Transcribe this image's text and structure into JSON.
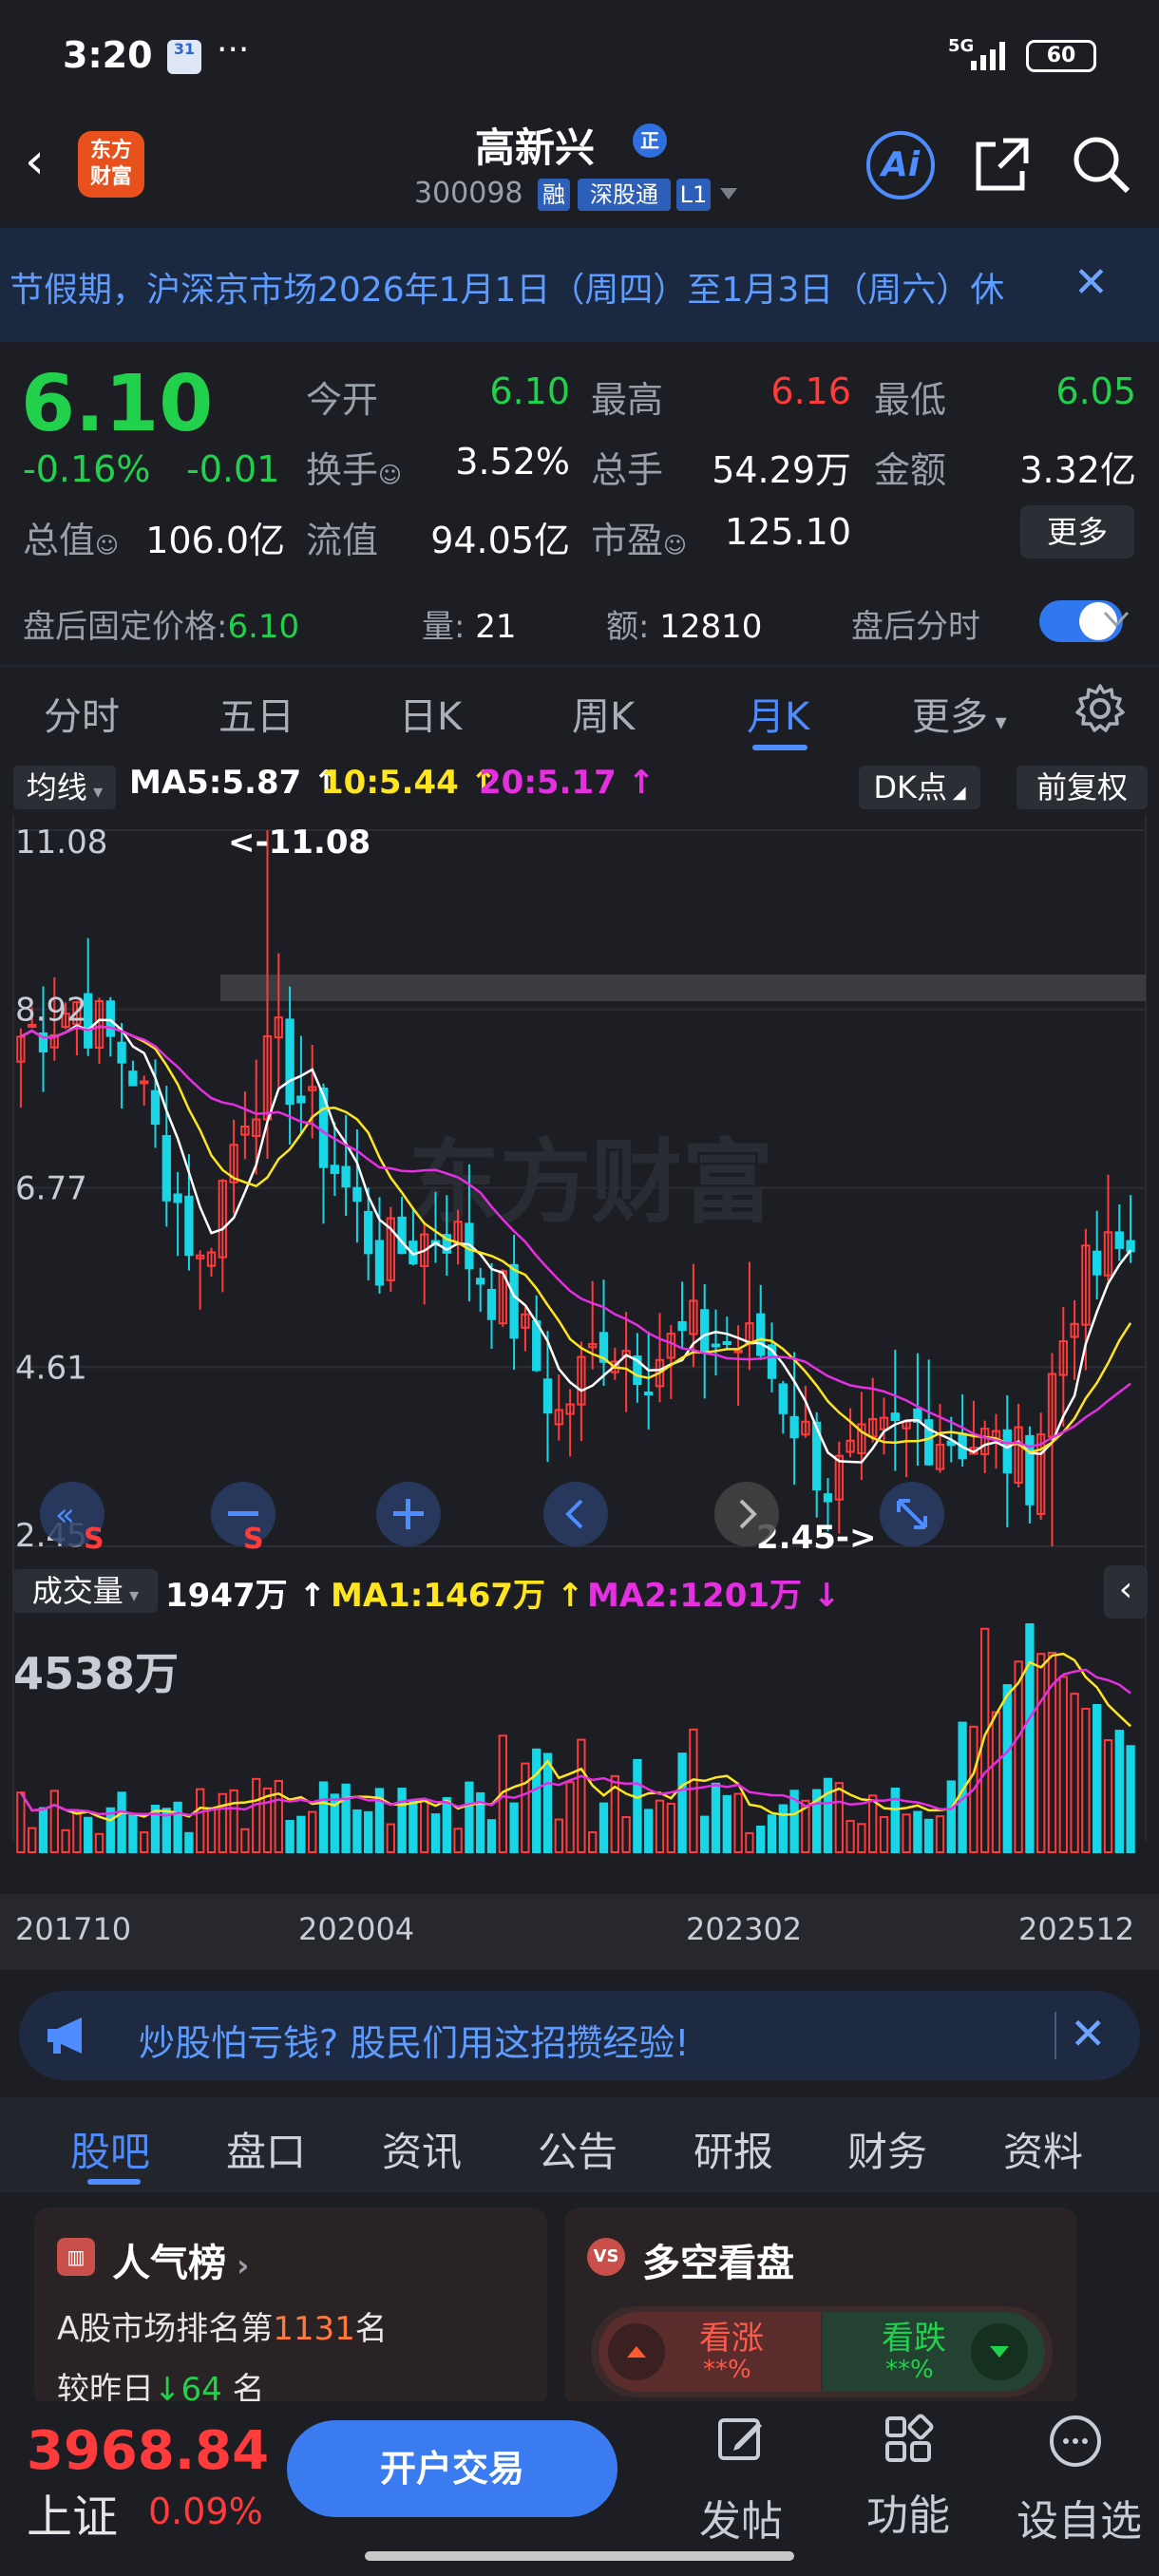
{
  "status": {
    "time": "3:20",
    "cal": "31",
    "dots": "···",
    "net": "5G",
    "battery": "60"
  },
  "header": {
    "logo": "东方\n财富",
    "title": "高新兴",
    "badge": "正",
    "code": "300098",
    "tags": [
      "融",
      "深股通",
      "L1"
    ]
  },
  "notice": {
    "text": "节假期，沪深京市场2026年1月1日（周四）至1月3日（周六）休",
    "close": "✕"
  },
  "quote": {
    "price": "6.10",
    "change_pct": "-0.16%",
    "change": "-0.01",
    "rows": [
      [
        {
          "l": "今开",
          "v": "6.10",
          "c": "gr"
        },
        {
          "l": "最高",
          "v": "6.16",
          "c": "rd"
        },
        {
          "l": "最低",
          "v": "6.05",
          "c": "gr"
        }
      ],
      [
        {
          "l": "换手",
          "v": "3.52%",
          "c": ""
        },
        {
          "l": "总手",
          "v": "54.29万",
          "c": ""
        },
        {
          "l": "金额",
          "v": "3.32亿",
          "c": ""
        }
      ],
      [
        {
          "l": "总值",
          "v": "106.0亿",
          "c": ""
        },
        {
          "l": "流值",
          "v": "94.05亿",
          "c": ""
        },
        {
          "l": "市盈",
          "v": "125.10",
          "c": ""
        }
      ]
    ],
    "more": "更多"
  },
  "after": {
    "fixed_label": "盘后固定价格:",
    "fixed_value": "6.10",
    "vol_label": "量:",
    "vol_value": "21",
    "amt_label": "额:",
    "amt_value": "12810",
    "switch_label": "盘后分时"
  },
  "tabs": [
    "分时",
    "五日",
    "日K",
    "周K",
    "月K",
    "更多"
  ],
  "active_tab": 4,
  "chart": {
    "ma_selector": "均线",
    "ma5": "MA5:5.87 ↑",
    "ma10": "10:5.44 ↑",
    "ma20": "20:5.17 ↑",
    "dk": "DK点",
    "fq": "前复权",
    "max_label": "<-11.08",
    "min_label": "2.45->",
    "y_ticks": [
      "11.08",
      "8.92",
      "6.77",
      "4.61",
      "2.45"
    ],
    "watermark": "东方财富",
    "vol_selector": "成交量",
    "vol_now": "1947万 ↑",
    "ma1": "MA1:1467万 ↑",
    "ma2": "MA2:1201万 ↓",
    "vol_max": "4538万",
    "x_ticks": [
      "201710",
      "202004",
      "202302",
      "202512"
    ],
    "colors": {
      "up": "#ff3b3b",
      "down": "#19d6e6",
      "ma5": "#ffffff",
      "ma10": "#ffe51f",
      "ma20": "#e52fe0"
    }
  },
  "chart_data": {
    "type": "candlestick",
    "xlabels": [
      "201710",
      "202004",
      "202302",
      "202512"
    ],
    "ylim": [
      2.45,
      11.08
    ],
    "high": 11.08,
    "low": 2.45,
    "vol_max_wan": 4538
  },
  "ad": {
    "text": "炒股怕亏钱? 股民们用这招攒经验!",
    "close": "✕"
  },
  "subtabs": [
    "股吧",
    "盘口",
    "资讯",
    "公告",
    "研报",
    "财务",
    "资料"
  ],
  "cards": {
    "popular": {
      "title": "人气榜",
      "line1_a": "A股市场排名第",
      "rank": "1131",
      "line1_b": "名",
      "line2_a": "较昨日",
      "delta": "64",
      "line2_b": " 名"
    },
    "vote": {
      "title": "多空看盘",
      "up": "看涨",
      "up_pct": "**%",
      "down": "看跌",
      "down_pct": "**%"
    }
  },
  "bottom": {
    "index_value": "3968.84",
    "index_name": "上证",
    "index_pct": "0.09%",
    "trade": "开户交易",
    "nav": [
      "发帖",
      "功能",
      "设自选"
    ]
  }
}
